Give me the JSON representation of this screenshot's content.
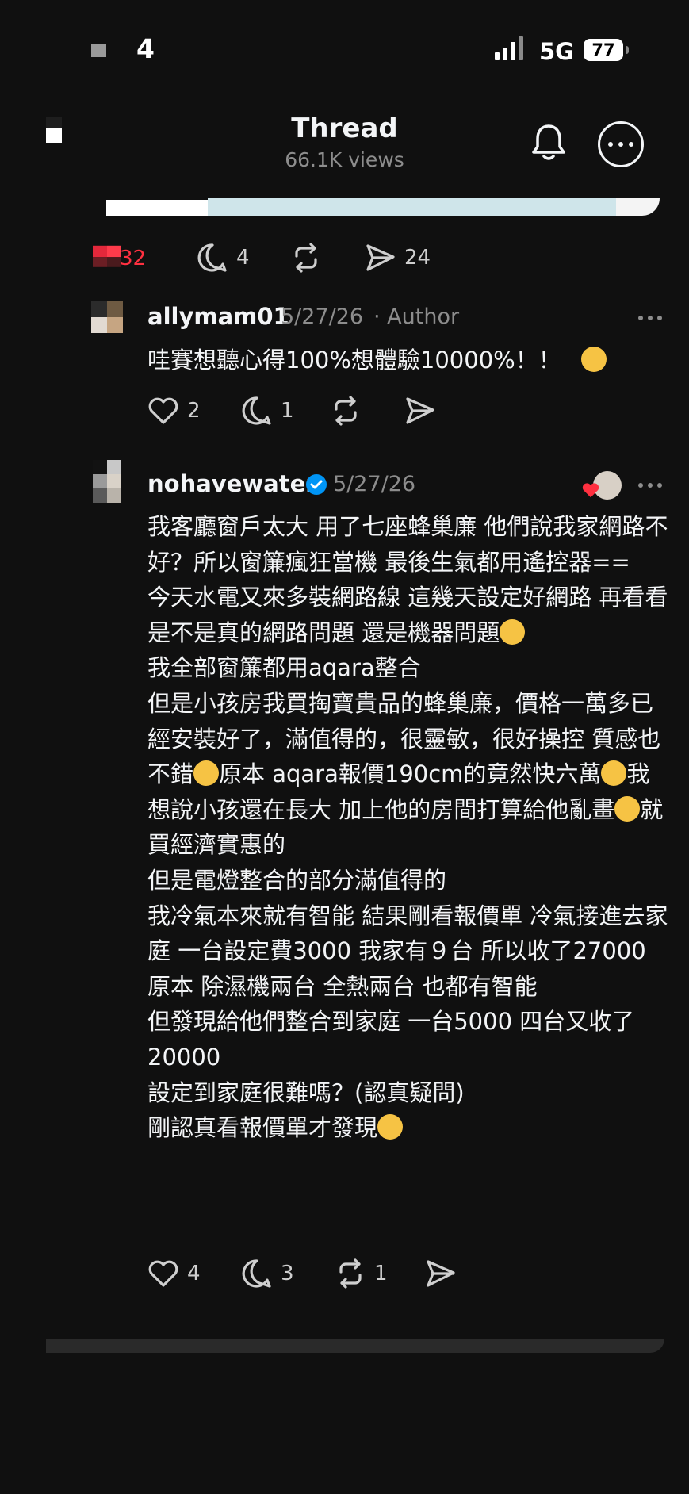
{
  "status_bar": {
    "time": "4",
    "network": "5G",
    "battery": "77"
  },
  "header": {
    "title": "Thread",
    "views": "66.1K views"
  },
  "post_actions": {
    "likes": "32",
    "replies": "4",
    "shares": "24"
  },
  "comments": [
    {
      "username": "allymam01",
      "date": "5/27/26",
      "tag": "· Author",
      "text": "哇賽想聽心得100%想體驗10000%！！",
      "likes": "2",
      "replies": "1",
      "reposts": ""
    },
    {
      "username": "nohavewater",
      "date": "5/27/26",
      "verified": true,
      "paragraphs": [
        "我客廳窗戶太大 用了七座蜂巢廉 他們說我家網路不好？所以窗簾瘋狂當機 最後生氣都用遙控器==",
        "今天水電又來多裝網路線 這幾天設定好網路 再看看是不是真的網路問題 還是機器問題",
        "我全部窗簾都用aqara整合",
        "但是小孩房我買掏寶貴品的蜂巢廉，價格一萬多已經安裝好了，滿值得的，很靈敏，很好操控 質感也不錯",
        "原本 aqara報價190cm的竟然快六萬",
        "我想說小孩還在長大 加上他的房間打算給他亂畫",
        "就買經濟實惠的",
        "但是電燈整合的部分滿值得的",
        "我冷氣本來就有智能 結果剛看報價單 冷氣接進去家庭 一台設定費3000 我家有９台 所以收了27000",
        "原本 除濕機兩台 全熱兩台 也都有智能",
        "但發現給他們整合到家庭 一台5000 四台又收了20000",
        "設定到家庭很難嗎？(認真疑問)",
        "剛認真看報價單才發現"
      ],
      "likes": "4",
      "replies": "3",
      "reposts": "1"
    }
  ],
  "colors": {
    "background": "#101010",
    "text": "#f3f5f7",
    "muted": "#8d8d8d",
    "like_red": "#ff3040",
    "verified": "#0095f6"
  }
}
